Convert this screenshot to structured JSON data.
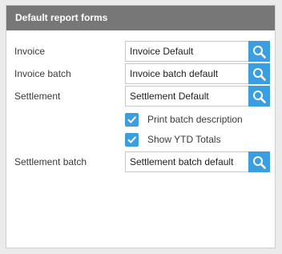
{
  "panel": {
    "title": "Default report forms"
  },
  "fields": [
    {
      "label": "Invoice",
      "value": "Invoice Default"
    },
    {
      "label": "Invoice batch",
      "value": "Invoice batch default"
    },
    {
      "label": "Settlement",
      "value": "Settlement Default"
    },
    {
      "label": "Settlement batch",
      "value": "Settlement batch default"
    }
  ],
  "checkboxes": [
    {
      "label": "Print batch description",
      "checked": true
    },
    {
      "label": "Show YTD Totals",
      "checked": true
    }
  ],
  "icons": {
    "search": "search-icon",
    "check": "check-icon"
  },
  "colors": {
    "header_bg": "#777777",
    "accent": "#3a9ee0"
  }
}
